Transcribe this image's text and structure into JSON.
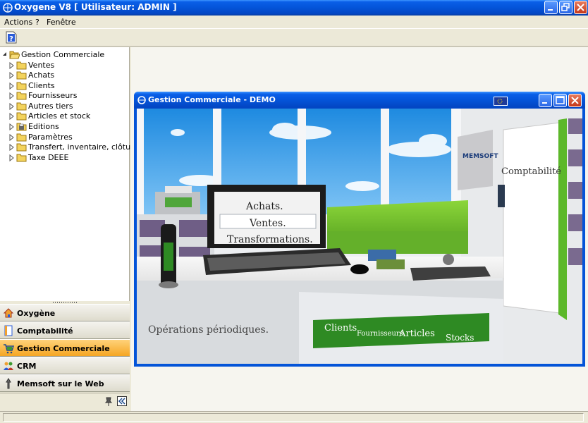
{
  "window": {
    "title": "Oxygene V8 [ Utilisateur: ADMIN ]"
  },
  "menu": {
    "items": [
      "Actions",
      "?",
      "Fenêtre"
    ]
  },
  "tree": {
    "root": "Gestion Commerciale",
    "children": [
      "Ventes",
      "Achats",
      "Clients",
      "Fournisseurs",
      "Autres tiers",
      "Articles et stock",
      "Editions",
      "Paramètres",
      "Transfert, inventaire, clôture, ...",
      "Taxe DEEE"
    ]
  },
  "nav_bar": {
    "items": [
      "Oxygène",
      "Comptabilité",
      "Gestion Commerciale",
      "CRM",
      "Memsoft sur le Web"
    ],
    "active": "Gestion Commerciale"
  },
  "child_window": {
    "title": "Gestion Commerciale - DEMO",
    "scene": {
      "screen_lines": [
        "Achats.",
        "Ventes.",
        "Transformations."
      ],
      "door_sign": "Comptabilité",
      "brand": "MEMSOFT",
      "drawer_label": "Opérations périodiques.",
      "file_tabs": [
        "Clients",
        "Fournisseurs",
        "Articles",
        "Stocks"
      ]
    }
  },
  "colors": {
    "xp_blue": "#0454D8",
    "active_nav": "#F5A623",
    "sofa_green": "#6FC02A",
    "file_green": "#2E8A23"
  }
}
